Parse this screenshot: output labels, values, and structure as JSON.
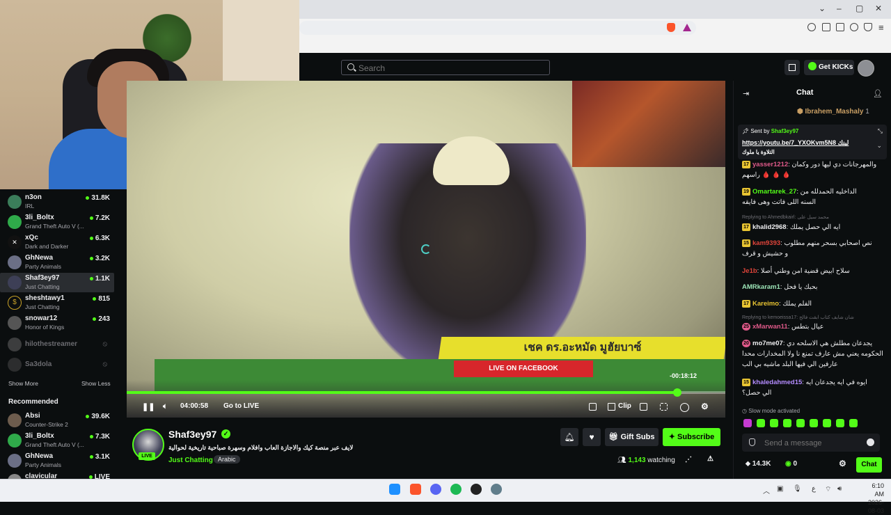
{
  "browser": {
    "window_controls": [
      "⌄",
      "–",
      "▢",
      "✕"
    ]
  },
  "header": {
    "search_placeholder": "Search",
    "get_kicks": "Get KICKs"
  },
  "sidebar": {
    "channels": [
      {
        "name": "n3on",
        "category": "IRL",
        "viewers": "31.8K",
        "color": "#3b7d5a"
      },
      {
        "name": "3li_Boltx",
        "category": "Grand Theft Auto V (...",
        "viewers": "7.2K",
        "color": "#2faa4a"
      },
      {
        "name": "xQc",
        "category": "Dark and Darker",
        "viewers": "6.3K",
        "color": "#111111"
      },
      {
        "name": "GhNewa",
        "category": "Party Animals",
        "viewers": "3.2K",
        "color": "#6b6f86"
      },
      {
        "name": "Shaf3ey97",
        "category": "Just Chatting",
        "viewers": "1.1K",
        "color": "#3d3f56"
      },
      {
        "name": "sheshtawy1",
        "category": "Just Chatting",
        "viewers": "815",
        "color": "#c9a227"
      },
      {
        "name": "snowar12",
        "category": "Honor of Kings",
        "viewers": "243",
        "color": "#555"
      },
      {
        "name": "hilothestreamer",
        "color": "#777"
      },
      {
        "name": "Sa3dola",
        "color": "#555"
      }
    ],
    "show_more": "Show More",
    "show_less": "Show Less",
    "recommended_title": "Recommended",
    "recommended": [
      {
        "name": "Absi",
        "category": "Counter-Strike 2",
        "viewers": "39.6K",
        "color": "#6d5c4d"
      },
      {
        "name": "3li_Boltx",
        "category": "Grand Theft Auto V (...",
        "viewers": "7.3K",
        "color": "#2faa4a"
      },
      {
        "name": "GhNewa",
        "category": "Party Animals",
        "viewers": "3.1K",
        "color": "#6b6f86"
      },
      {
        "name": "clavicular",
        "viewers": "LIVE",
        "color": "#888"
      }
    ]
  },
  "video": {
    "chyron": "เชค ดร.อะหมัด มูฮัยบาซ์",
    "live_banner": "LIVE ON FACEBOOK",
    "time_remaining": "-00:18:12",
    "current_time": "04:00:58",
    "go_live": "Go to LIVE",
    "clip": "Clip",
    "progress_fraction": 0.92
  },
  "stream": {
    "streamer": "Shaf3ey97",
    "live_badge": "LIVE",
    "title": "لايف عبر منصة كيك والاجازة العاب وافلام وسهرة صباحية تاريخية لحوالية",
    "category": "Just Chatting",
    "tag": "Arabic",
    "gift_subs": "Gift Subs",
    "subscribe": "Subscribe",
    "watching_count": "1,143",
    "watching_label": "watching"
  },
  "chat": {
    "title": "Chat",
    "top_gifter": "Ibrahem_Mashaly",
    "top_gifter_count": "1",
    "pinned_sent_by": "Sent by",
    "pinned_user": "Shaf3ey97",
    "pinned_url": "https://youtu.be/7_YXOKvm5N8",
    "pinned_text_ar": "لينك",
    "pinned_line2": "التلاوة يا ملوك",
    "messages": [
      {
        "badge": "17",
        "user": "yasser1212",
        "color": "#e05a8a",
        "text": "والمهرجانات دي ليها دور وكمان",
        "text2": "راسهم 🩸 🩸 🩸"
      },
      {
        "badge": "19",
        "user": "Omartarek_27",
        "color": "#53fc18",
        "text": "الداخليه الحمدلله من",
        "text2": "السنه اللى فاتت وهى فايقه"
      },
      {
        "badge": "17",
        "user": "khalid2968",
        "color": "#ffffff",
        "text": "ايه الي حصل يملك"
      },
      {
        "badge": "15",
        "user": "kam9393",
        "color": "#e0443a",
        "text": "نص اصحابي بسحر منهم مطلوب",
        "text2": "و حشيش و قرف"
      },
      {
        "badge": "",
        "user": "Je1b",
        "color": "#e0443a",
        "text": "سلاح ابيض قضية امن وطني أصلا"
      },
      {
        "badge": "",
        "user": "AMRkaram1",
        "color": "#9be3b6",
        "text": "بحبك يا فحل"
      },
      {
        "badge": "17",
        "user": "Kareimo",
        "color": "#e8c432",
        "text": "الفلم يملك"
      },
      {
        "badge": "25",
        "user": "xMarwan11",
        "color": "#e05a8a",
        "text": "عيال بتطس"
      },
      {
        "badge": "20",
        "user": "mo7me07",
        "color": "#e6e6e9",
        "text": "يجدعان مطلش هي الاسلحه دي",
        "text2": "الحكومه يعني مش عارف تمنع نا ولا المخدارات محدا",
        "text3": "عارفين الي فيها البلد ماشيه بي الب"
      },
      {
        "badge": "15",
        "user": "khaledahmed15",
        "color": "#b48cff",
        "text": "ايوه في ايه يجدعان ايه",
        "text2": "الي حصل؟"
      }
    ],
    "reply1": "Replying to Ahmedbkairl: محمد سيل على",
    "reply2": "Replying to kemoeissa17: شان شايف كتاب ابقت فالح",
    "slow_mode": "Slow mode activated",
    "send_placeholder": "Send a message",
    "kicks_count": "14.3K",
    "zero_count": "0",
    "chat_button": "Chat"
  },
  "taskbar": {
    "time": "6:10 AM",
    "date": "2026-08-03",
    "lang": "ع"
  }
}
